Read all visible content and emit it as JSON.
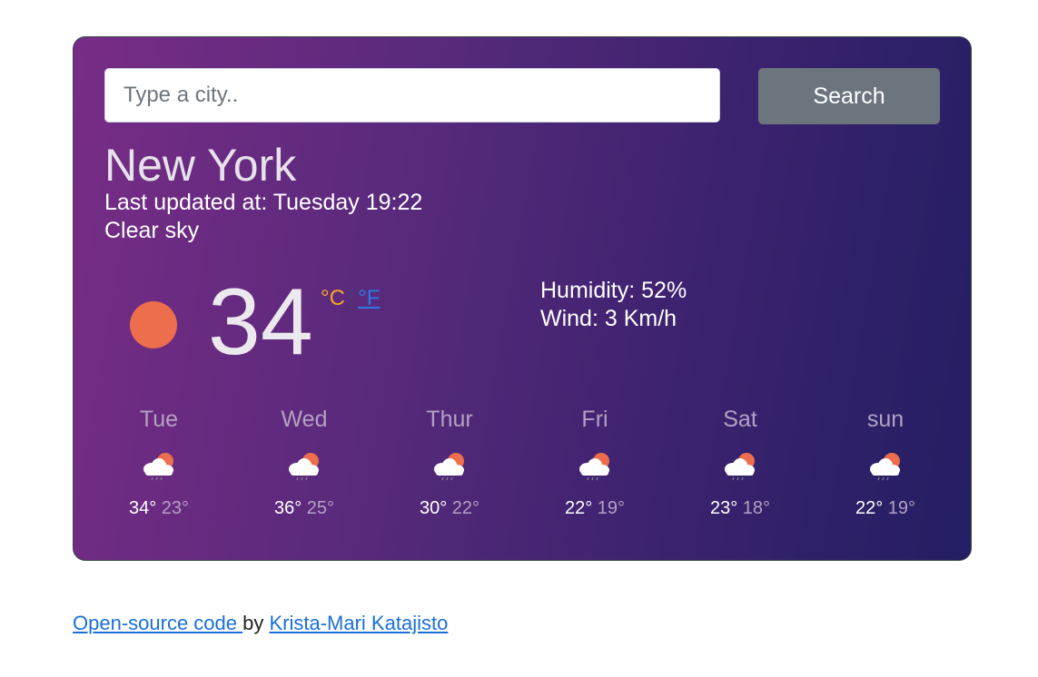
{
  "search": {
    "placeholder": "Type a city..",
    "value": "",
    "button_label": "Search"
  },
  "current": {
    "city": "New York",
    "updated": "Last updated at: Tuesday 19:22",
    "description": "Clear sky",
    "icon": "sun-icon",
    "temperature": "34",
    "unit_c": "°C",
    "unit_separator": "|",
    "unit_f": "°F",
    "humidity": "Humidity: 52%",
    "wind": "Wind: 3 Km/h"
  },
  "colors": {
    "sun": "#ec6e4c",
    "unit_active": "#f5a623",
    "link": "#2a7ae2",
    "search_button": "#6c757d"
  },
  "forecast": [
    {
      "day": "Tue",
      "max": "34°",
      "min": "23°",
      "icon": "cloud-sun-rain-icon"
    },
    {
      "day": "Wed",
      "max": "36°",
      "min": "25°",
      "icon": "cloud-sun-rain-icon"
    },
    {
      "day": "Thur",
      "max": "30°",
      "min": "22°",
      "icon": "cloud-sun-rain-icon"
    },
    {
      "day": "Fri",
      "max": "22°",
      "min": "19°",
      "icon": "cloud-sun-rain-icon"
    },
    {
      "day": "Sat",
      "max": "23°",
      "min": "18°",
      "icon": "cloud-sun-rain-icon"
    },
    {
      "day": "sun",
      "max": "22°",
      "min": "19°",
      "icon": "cloud-sun-rain-icon"
    }
  ],
  "footer": {
    "code_link": "Open-source code ",
    "by": "by",
    "author_link": "Krista-Mari Katajisto"
  }
}
